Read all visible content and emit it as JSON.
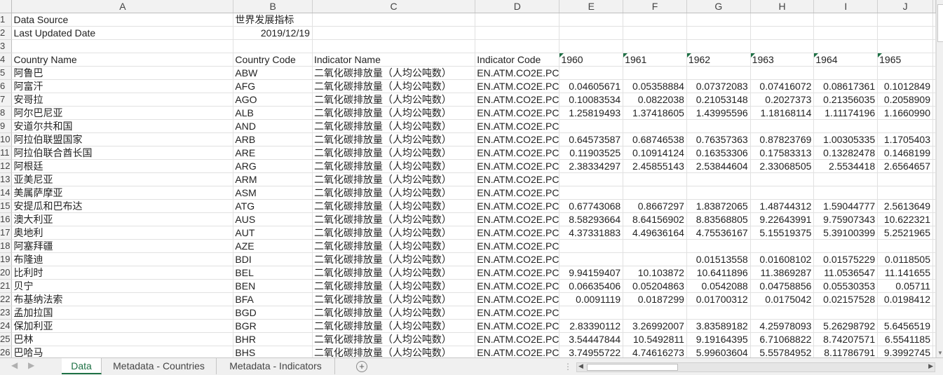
{
  "columns": [
    "A",
    "B",
    "C",
    "D",
    "E",
    "F",
    "G",
    "H",
    "I",
    "J"
  ],
  "rows": [
    {
      "n": "1",
      "a": "Data Source",
      "b": "世界发展指标",
      "c": "",
      "d": "",
      "v": [
        "",
        "",
        "",
        "",
        "",
        ""
      ]
    },
    {
      "n": "2",
      "a": "Last Updated Date",
      "b": "2019/12/19",
      "c": "",
      "d": "",
      "v": [
        "",
        "",
        "",
        "",
        "",
        ""
      ]
    },
    {
      "n": "3",
      "a": "",
      "b": "",
      "c": "",
      "d": "",
      "v": [
        "",
        "",
        "",
        "",
        "",
        ""
      ]
    },
    {
      "n": "4",
      "a": "Country Name",
      "b": "Country Code",
      "c": "Indicator Name",
      "d": "Indicator Code",
      "v": [
        "1960",
        "1961",
        "1962",
        "1963",
        "1964",
        "1965"
      ]
    },
    {
      "n": "5",
      "a": "阿鲁巴",
      "b": "ABW",
      "c": "二氧化碳排放量（人均公吨数）",
      "d": "EN.ATM.CO2E.PC",
      "v": [
        "",
        "",
        "",
        "",
        "",
        ""
      ]
    },
    {
      "n": "6",
      "a": "阿富汗",
      "b": "AFG",
      "c": "二氧化碳排放量（人均公吨数）",
      "d": "EN.ATM.CO2E.PC",
      "v": [
        "0.04605671",
        "0.05358884",
        "0.07372083",
        "0.07416072",
        "0.08617361",
        "0.1012849"
      ]
    },
    {
      "n": "7",
      "a": "安哥拉",
      "b": "AGO",
      "c": "二氧化碳排放量（人均公吨数）",
      "d": "EN.ATM.CO2E.PC",
      "v": [
        "0.10083534",
        "0.0822038",
        "0.21053148",
        "0.2027373",
        "0.21356035",
        "0.2058909"
      ]
    },
    {
      "n": "8",
      "a": "阿尔巴尼亚",
      "b": "ALB",
      "c": "二氧化碳排放量（人均公吨数）",
      "d": "EN.ATM.CO2E.PC",
      "v": [
        "1.25819493",
        "1.37418605",
        "1.43995596",
        "1.18168114",
        "1.11174196",
        "1.1660990"
      ]
    },
    {
      "n": "9",
      "a": "安道尔共和国",
      "b": "AND",
      "c": "二氧化碳排放量（人均公吨数）",
      "d": "EN.ATM.CO2E.PC",
      "v": [
        "",
        "",
        "",
        "",
        "",
        ""
      ]
    },
    {
      "n": "10",
      "a": "阿拉伯联盟国家",
      "b": "ARB",
      "c": "二氧化碳排放量（人均公吨数）",
      "d": "EN.ATM.CO2E.PC",
      "v": [
        "0.64573587",
        "0.68746538",
        "0.76357363",
        "0.87823769",
        "1.00305335",
        "1.1705403"
      ]
    },
    {
      "n": "11",
      "a": "阿拉伯联合酋长国",
      "b": "ARE",
      "c": "二氧化碳排放量（人均公吨数）",
      "d": "EN.ATM.CO2E.PC",
      "v": [
        "0.11903525",
        "0.10914124",
        "0.16353306",
        "0.17583313",
        "0.13282478",
        "0.1468199"
      ]
    },
    {
      "n": "12",
      "a": "阿根廷",
      "b": "ARG",
      "c": "二氧化碳排放量（人均公吨数）",
      "d": "EN.ATM.CO2E.PC",
      "v": [
        "2.38334297",
        "2.45855143",
        "2.53844604",
        "2.33068505",
        "2.5534418",
        "2.6564657"
      ]
    },
    {
      "n": "13",
      "a": "亚美尼亚",
      "b": "ARM",
      "c": "二氧化碳排放量（人均公吨数）",
      "d": "EN.ATM.CO2E.PC",
      "v": [
        "",
        "",
        "",
        "",
        "",
        ""
      ]
    },
    {
      "n": "14",
      "a": "美属萨摩亚",
      "b": "ASM",
      "c": "二氧化碳排放量（人均公吨数）",
      "d": "EN.ATM.CO2E.PC",
      "v": [
        "",
        "",
        "",
        "",
        "",
        ""
      ]
    },
    {
      "n": "15",
      "a": "安提瓜和巴布达",
      "b": "ATG",
      "c": "二氧化碳排放量（人均公吨数）",
      "d": "EN.ATM.CO2E.PC",
      "v": [
        "0.67743068",
        "0.8667297",
        "1.83872065",
        "1.48744312",
        "1.59044777",
        "2.5613649"
      ]
    },
    {
      "n": "16",
      "a": "澳大利亚",
      "b": "AUS",
      "c": "二氧化碳排放量（人均公吨数）",
      "d": "EN.ATM.CO2E.PC",
      "v": [
        "8.58293664",
        "8.64156902",
        "8.83568805",
        "9.22643991",
        "9.75907343",
        "10.622321"
      ]
    },
    {
      "n": "17",
      "a": "奥地利",
      "b": "AUT",
      "c": "二氧化碳排放量（人均公吨数）",
      "d": "EN.ATM.CO2E.PC",
      "v": [
        "4.37331883",
        "4.49636164",
        "4.75536167",
        "5.15519375",
        "5.39100399",
        "5.2521965"
      ]
    },
    {
      "n": "18",
      "a": "阿塞拜疆",
      "b": "AZE",
      "c": "二氧化碳排放量（人均公吨数）",
      "d": "EN.ATM.CO2E.PC",
      "v": [
        "",
        "",
        "",
        "",
        "",
        ""
      ]
    },
    {
      "n": "19",
      "a": "布隆迪",
      "b": "BDI",
      "c": "二氧化碳排放量（人均公吨数）",
      "d": "EN.ATM.CO2E.PC",
      "v": [
        "",
        "",
        "0.01513558",
        "0.01608102",
        "0.01575229",
        "0.0118505"
      ]
    },
    {
      "n": "20",
      "a": "比利时",
      "b": "BEL",
      "c": "二氧化碳排放量（人均公吨数）",
      "d": "EN.ATM.CO2E.PC",
      "v": [
        "9.94159407",
        "10.103872",
        "10.6411896",
        "11.3869287",
        "11.0536547",
        "11.141655"
      ]
    },
    {
      "n": "21",
      "a": "贝宁",
      "b": "BEN",
      "c": "二氧化碳排放量（人均公吨数）",
      "d": "EN.ATM.CO2E.PC",
      "v": [
        "0.06635406",
        "0.05204863",
        "0.0542088",
        "0.04758856",
        "0.05530353",
        "0.05711"
      ]
    },
    {
      "n": "22",
      "a": "布基纳法索",
      "b": "BFA",
      "c": "二氧化碳排放量（人均公吨数）",
      "d": "EN.ATM.CO2E.PC",
      "v": [
        "0.0091119",
        "0.0187299",
        "0.01700312",
        "0.0175042",
        "0.02157528",
        "0.0198412"
      ]
    },
    {
      "n": "23",
      "a": "孟加拉国",
      "b": "BGD",
      "c": "二氧化碳排放量（人均公吨数）",
      "d": "EN.ATM.CO2E.PC",
      "v": [
        "",
        "",
        "",
        "",
        "",
        ""
      ]
    },
    {
      "n": "24",
      "a": "保加利亚",
      "b": "BGR",
      "c": "二氧化碳排放量（人均公吨数）",
      "d": "EN.ATM.CO2E.PC",
      "v": [
        "2.83390112",
        "3.26992007",
        "3.83589182",
        "4.25978093",
        "5.26298792",
        "5.6456519"
      ]
    },
    {
      "n": "25",
      "a": "巴林",
      "b": "BHR",
      "c": "二氧化碳排放量（人均公吨数）",
      "d": "EN.ATM.CO2E.PC",
      "v": [
        "3.54447844",
        "10.5492811",
        "9.19164395",
        "6.71068822",
        "8.74207571",
        "6.5541185"
      ]
    },
    {
      "n": "26",
      "a": "巴哈马",
      "b": "BHS",
      "c": "二氧化碳排放量（人均公吨数）",
      "d": "EN.ATM.CO2E.PC",
      "v": [
        "3.74955722",
        "4.74616273",
        "5.99603604",
        "5.55784952",
        "8.11786791",
        "9.3992745"
      ]
    }
  ],
  "tabs": [
    {
      "label": "Data",
      "active": true
    },
    {
      "label": "Metadata - Countries",
      "active": false
    },
    {
      "label": "Metadata - Indicators",
      "active": false
    }
  ],
  "add_sheet_symbol": "+",
  "icons": {
    "tab_prev": "triangle-left-icon",
    "tab_next": "triangle-right-icon",
    "add": "plus-circle-icon",
    "splitter": "dots-icon"
  }
}
